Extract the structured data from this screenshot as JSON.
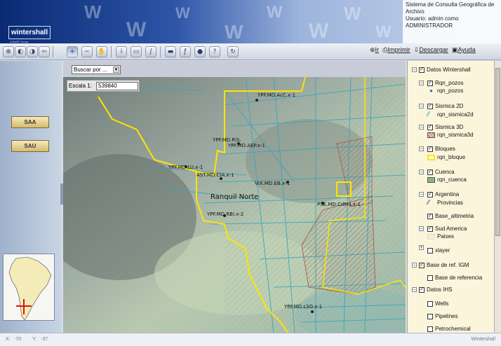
{
  "header": {
    "logo_text": "wintershall",
    "logo_sub": "A BASF Group",
    "title": "Sistema de Consulta Geográfica de Archivo",
    "user_line": "Usuario: admin como",
    "role": "ADMINISTRADOR"
  },
  "toolbar": {
    "tools": [
      {
        "icon": "zoom-full-icon"
      },
      {
        "icon": "zoom-prev-icon"
      },
      {
        "icon": "zoom-next-icon"
      },
      {
        "icon": "zoom-back-icon"
      },
      {
        "icon": "zoom-in-icon"
      },
      {
        "icon": "zoom-out-icon"
      },
      {
        "icon": "pan-hand-icon"
      },
      {
        "icon": "identify-icon"
      },
      {
        "icon": "select-icon"
      },
      {
        "icon": "hyperlink-icon"
      },
      {
        "icon": "measure-icon"
      },
      {
        "icon": "buffer-icon"
      },
      {
        "icon": "locate-icon"
      },
      {
        "icon": "query-icon"
      },
      {
        "icon": "refresh-icon"
      }
    ],
    "links": {
      "ir": "Ir",
      "imprimir": "Imprimir",
      "descargar": "Descargar",
      "ayuda": "Ayuda"
    }
  },
  "sidebar": {
    "buttons": [
      "SAA",
      "SAU"
    ]
  },
  "map": {
    "search_dropdown": "Buscar por ...",
    "scale_label": "Escala 1:",
    "scale_value": "539840",
    "labels": {
      "acc": "YPF.MD.AcC.x-1",
      "ris": "YPF.MD.RiS.",
      "aep": "YPF.MD.AEP.x-1",
      "luc": "YPF.MD.LU.x-1",
      "ast": "AST.MD.CIA.x-1",
      "vix": "VIX.MD.EB.x-1",
      "cdm": "PSE.MD.CdMa.x-1",
      "rbi": "YPF.MD.RBI.x-2",
      "lso": "YPF.MD.LSO.x-1",
      "ranquil": "Ranquil Norte"
    }
  },
  "layers": {
    "datos_wintershall": "Datos Wintershall",
    "rqn_pozos": "Rqn_pozos",
    "rqn_pozos_legend": "rqn_pozos",
    "sismica2d": "Sismica 2D",
    "rqn_sismica2d": "rqn_sismica2d",
    "sismica3d": "Sismica 3D",
    "rqn_sismica3d": "rqn_sismica3d",
    "bloques": "Bloques",
    "rqn_bloque": "rqn_bloque",
    "cuenca": "Cuenca",
    "rqn_cuenca": "rqn_cuenca",
    "argentina": "Argentina",
    "provincias": "Provincias",
    "base_altimetria": "Base_altimetria",
    "sud_america": "Sud America",
    "paises": "Paises",
    "xlayer": "xlayer",
    "base_ref_igm": "Base de ref. IGM",
    "base_referencia": "Base de referencia",
    "datos_ihs": "Datos IHS",
    "wells": "Wells",
    "pipelines": "Pipelines",
    "petrochemical": "Petrochemical",
    "colors": {
      "pozos": "#2a6fb0",
      "sismica2d": "#3aa6b8",
      "sismica3d": "#c26a5a",
      "bloque": "#ffe400",
      "cuenca": "#8fb18a"
    }
  },
  "status": {
    "x_label": "X:",
    "x_value": "-70",
    "y_label": "Y:",
    "y_value": "-37",
    "brand": "Wintershall"
  }
}
